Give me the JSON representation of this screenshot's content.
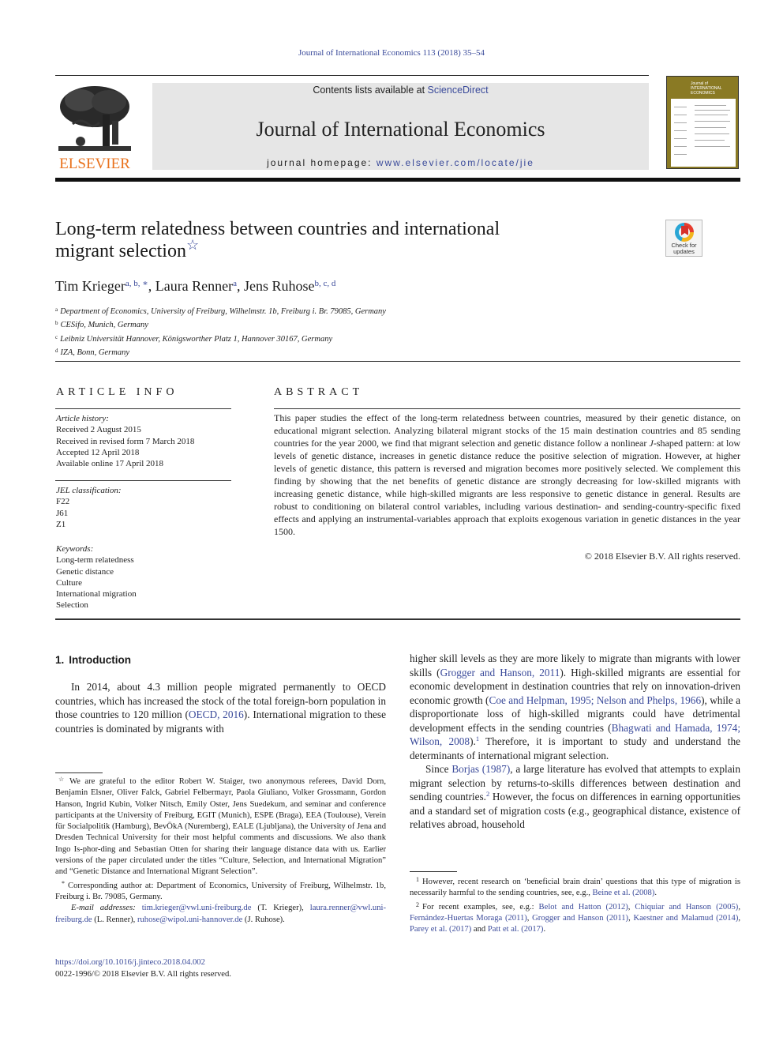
{
  "citation": "Journal of International Economics 113 (2018) 35–54",
  "header": {
    "publisher_wordmark": "ELSEVIER",
    "contents_prefix": "Contents lists available at ",
    "contents_link": "ScienceDirect",
    "journal_title": "Journal of International Economics",
    "homepage_prefix": "journal homepage: ",
    "homepage_link": "www.elsevier.com/locate/jie",
    "cover_title": "Journal of INTERNATIONAL ECONOMICS"
  },
  "article": {
    "title_line1": "Long-term relatedness between countries and international",
    "title_line2": "migrant selection",
    "title_marker": "☆",
    "crossmark_label": "Check for updates",
    "authors": [
      {
        "name": "Tim Krieger",
        "sup": "a, b, ∗"
      },
      {
        "name": "Laura Renner",
        "sup": "a"
      },
      {
        "name": "Jens Ruhose",
        "sup": "b, c, d"
      }
    ],
    "affiliations": [
      {
        "mark": "a",
        "text": "Department of Economics, University of Freiburg, Wilhelmstr. 1b, Freiburg i. Br. 79085, Germany"
      },
      {
        "mark": "b",
        "text": "CESifo, Munich, Germany"
      },
      {
        "mark": "c",
        "text": "Leibniz Universität Hannover, Königsworther Platz 1, Hannover 30167, Germany"
      },
      {
        "mark": "d",
        "text": "IZA, Bonn, Germany"
      }
    ]
  },
  "article_info": {
    "heading": "ARTICLE INFO",
    "history_label": "Article history:",
    "history": [
      "Received 2 August 2015",
      "Received in revised form 7 March 2018",
      "Accepted 12 April 2018",
      "Available online 17 April 2018"
    ],
    "jel_label": "JEL classification:",
    "jel": [
      "F22",
      "J61",
      "Z1"
    ],
    "keywords_label": "Keywords:",
    "keywords": [
      "Long-term relatedness",
      "Genetic distance",
      "Culture",
      "International migration",
      "Selection"
    ]
  },
  "abstract": {
    "heading": "ABSTRACT",
    "text_a": "This paper studies the effect of the long-term relatedness between countries, measured by their genetic distance, on educational migrant selection. Analyzing bilateral migrant stocks of the 15 main destination countries and 85 sending countries for the year 2000, we find that migrant selection and genetic distance follow a nonlinear ",
    "text_italic": "J",
    "text_b": "-shaped pattern: at low levels of genetic distance, increases in genetic distance reduce the positive selection of migration. However, at higher levels of genetic distance, this pattern is reversed and migration becomes more positively selected. We complement this finding by showing that the net benefits of genetic distance are strongly decreasing for low-skilled migrants with increasing genetic distance, while high-skilled migrants are less responsive to genetic distance in general. Results are robust to conditioning on bilateral control variables, including various destination- and sending-country-specific fixed effects and applying an instrumental-variables approach that exploits exogenous variation in genetic distances in the year 1500.",
    "copyright": "© 2018 Elsevier B.V. All rights reserved."
  },
  "introduction": {
    "number": "1.",
    "heading": "Introduction",
    "p1_a": "In 2014, about 4.3 million people migrated permanently to OECD countries, which has increased the stock of the total foreign-born population in those countries to 120 million (",
    "p1_link": "OECD, 2016",
    "p1_b": "). International migration to these countries is dominated by migrants with",
    "p2_a": "higher skill levels as they are more likely to migrate than migrants with lower skills (",
    "p2_link1": "Grogger and Hanson, 2011",
    "p2_b": "). High-skilled migrants are essential for economic development in destination countries that rely on innovation-driven economic growth (",
    "p2_link2": "Coe and Helpman, 1995; Nelson and Phelps, 1966",
    "p2_c": "), while a disproportionate loss of high-skilled migrants could have detrimental development effects in the sending countries (",
    "p2_link3": "Bhagwati and Hamada, 1974; Wilson, 2008",
    "p2_d": ").",
    "p2_fn": "1",
    "p2_e": " Therefore, it is important to study and understand the determinants of international migrant selection.",
    "p3_a": "Since ",
    "p3_link": "Borjas (1987)",
    "p3_b": ", a large literature has evolved that attempts to explain migrant selection by returns-to-skills differences between destination and sending countries.",
    "p3_fn": "2",
    "p3_c": " However, the focus on differences in earning opportunities and a standard set of migration costs (e.g., geographical distance, existence of relatives abroad, household"
  },
  "footnotes_left": {
    "ack_mark": "☆",
    "ack": "We are grateful to the editor Robert W. Staiger, two anonymous referees, David Dorn, Benjamin Elsner, Oliver Falck, Gabriel Felbermayr, Paola Giuliano, Volker Grossmann, Gordon Hanson, Ingrid Kubin, Volker Nitsch, Emily Oster, Jens Suedekum, and seminar and conference participants at the University of Freiburg, EGIT (Munich), ESPE (Braga), EEA (Toulouse), Verein für Socialpolitik (Hamburg), BevÖkA (Nuremberg), EALE (Ljubljana), the University of Jena and Dresden Technical University for their most helpful comments and discussions. We also thank Ingo Is-phor-ding and Sebastian Otten for sharing their language distance data with us. Earlier versions of the paper circulated under the titles “Culture, Selection, and International Migration” and “Genetic Distance and International Migrant Selection”.",
    "corr_mark": "*",
    "corr": "Corresponding author at: Department of Economics, University of Freiburg, Wilhelmstr. 1b, Freiburg i. Br. 79085, Germany.",
    "email_label": "E-mail addresses:",
    "email1": "tim.krieger@vwl.uni-freiburg.de",
    "email1_who": " (T. Krieger), ",
    "email2": "laura.renner@vwl.uni-freiburg.de",
    "email2_who": " (L. Renner), ",
    "email3": "ruhose@wipol.uni-hannover.de",
    "email3_who": " (J. Ruhose)."
  },
  "footnotes_right": {
    "fn1_mark": "1",
    "fn1_text": "However, recent research on ‘beneficial brain drain’ questions that this type of migration is necessarily harmful to the sending countries, see, e.g., ",
    "fn1_link": "Beine et al. (2008)",
    "fn1_end": ".",
    "fn2_mark": "2",
    "fn2_text": "For recent examples, see, e.g.: ",
    "fn2_links": [
      "Belot and Hatton (2012)",
      "Chiquiar and Hanson (2005)",
      "Fernández-Huertas Moraga (2011)",
      "Grogger and Hanson (2011)",
      "Kaestner and Malamud (2014)",
      "Parey et al. (2017)",
      "Patt et al. (2017)"
    ],
    "fn2_sep": ", ",
    "fn2_and": " and ",
    "fn2_end": "."
  },
  "doi": {
    "link": "https://doi.org/10.1016/j.jinteco.2018.04.002",
    "issn_copyright": "0022-1996/© 2018 Elsevier B.V. All rights reserved."
  }
}
